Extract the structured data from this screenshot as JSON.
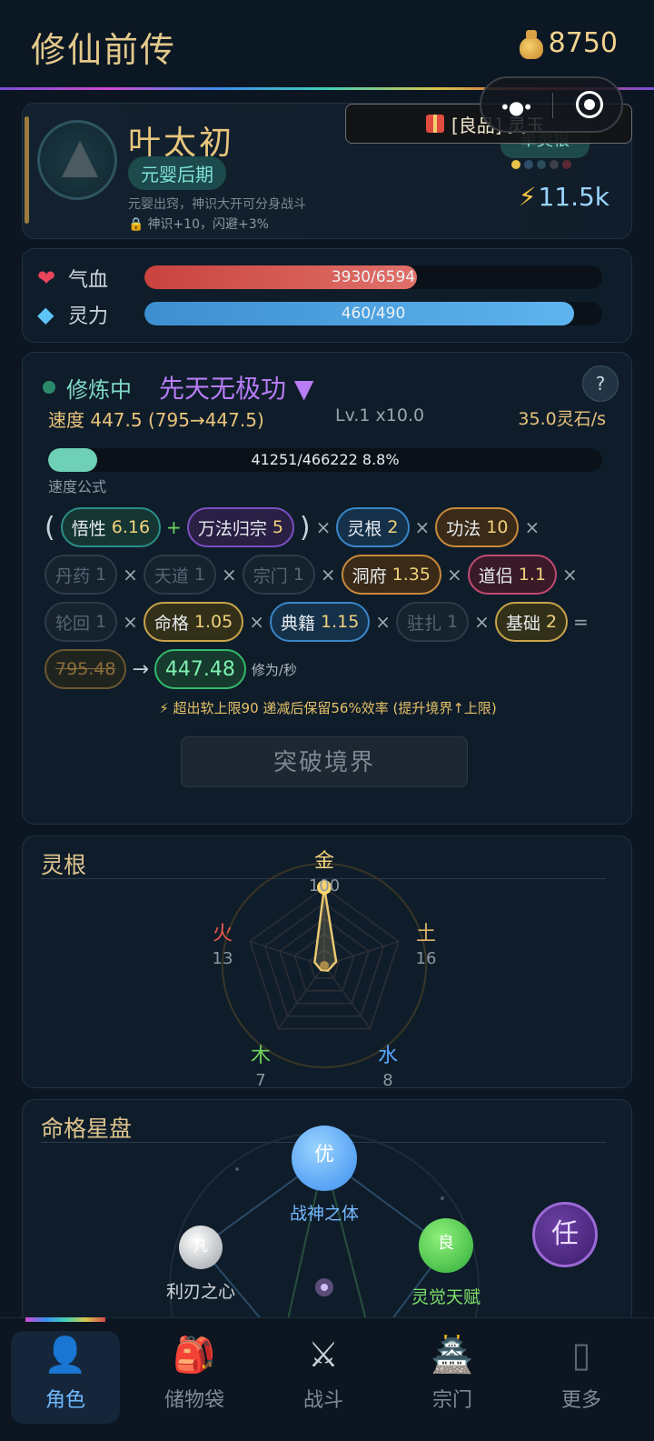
{
  "header": {
    "title": "修仙前传",
    "gold": "8750"
  },
  "profile": {
    "name": "叶太初",
    "realm": "元婴后期",
    "desc": "元婴出窍，神识大开可分身战斗",
    "perk": "神识+10，闪避+3%",
    "root_tag": "单灵根",
    "power": "11.5k",
    "dot_colors": [
      "#e8c24a",
      "#2f4e6a",
      "#2a4d5a",
      "#3a3f4a",
      "#5a2a33"
    ]
  },
  "gift": {
    "label": "[良品] 灵玉"
  },
  "stats": {
    "hp_label": "气血",
    "hp_text": "3930/6594",
    "hp_fraction": 0.596,
    "mp_label": "灵力",
    "mp_text": "460/490",
    "mp_fraction": 0.939
  },
  "cultivation": {
    "state": "修炼中",
    "skill": "先天无极功 ▼",
    "speed": "速度 447.5 (795→447.5)",
    "level": "Lv.1 x10.0",
    "rate": "35.0灵石/s",
    "exp_text": "41251/466222  8.8%",
    "exp_fraction": 0.088,
    "formula_label": "速度公式",
    "chips": [
      {
        "k": "悟性",
        "v": "6.16",
        "style": "teal"
      },
      {
        "k": "万法归宗",
        "v": "5",
        "style": "purple"
      },
      {
        "k": "灵根",
        "v": "2",
        "style": "blue"
      },
      {
        "k": "功法",
        "v": "10",
        "style": "orange"
      },
      {
        "k": "丹药",
        "v": "1",
        "style": "grey"
      },
      {
        "k": "天道",
        "v": "1",
        "style": "grey"
      },
      {
        "k": "宗门",
        "v": "1",
        "style": "grey"
      },
      {
        "k": "洞府",
        "v": "1.35",
        "style": "orange"
      },
      {
        "k": "道侣",
        "v": "1.1",
        "style": "pink"
      },
      {
        "k": "轮回",
        "v": "1",
        "style": "grey"
      },
      {
        "k": "命格",
        "v": "1.05",
        "style": "gold"
      },
      {
        "k": "典籍",
        "v": "1.15",
        "style": "blue"
      },
      {
        "k": "驻扎",
        "v": "1",
        "style": "grey"
      },
      {
        "k": "基础",
        "v": "2",
        "style": "gold"
      }
    ],
    "raw_result": "795.48",
    "result": "447.48",
    "result_unit": "修为/秒",
    "note": "⚡ 超出软上限90 递减后保留56%效率 (提升境界↑上限)",
    "breakthrough": "突破境界"
  },
  "roots": {
    "title": "灵根",
    "elements": [
      {
        "name": "金",
        "value": 100,
        "color": "#f0d27a"
      },
      {
        "name": "土",
        "value": 16,
        "color": "#e0b56a"
      },
      {
        "name": "水",
        "value": 8,
        "color": "#5aa8ff"
      },
      {
        "name": "木",
        "value": 7,
        "color": "#6fd45a"
      },
      {
        "name": "火",
        "value": 13,
        "color": "#e85a4a"
      }
    ]
  },
  "stars": {
    "title": "命格星盘",
    "top": {
      "grade": "优",
      "name": "战神之体"
    },
    "left": {
      "grade": "凡",
      "name": "利刃之心"
    },
    "right": {
      "grade": "良",
      "name": "灵觉天赋"
    },
    "ren": "任"
  },
  "nav": [
    {
      "label": "角色",
      "icon": "👤"
    },
    {
      "label": "储物袋",
      "icon": "🎒"
    },
    {
      "label": "战斗",
      "icon": "⚔"
    },
    {
      "label": "宗门",
      "icon": "🏯"
    },
    {
      "label": "更多",
      "icon": "▯"
    }
  ]
}
